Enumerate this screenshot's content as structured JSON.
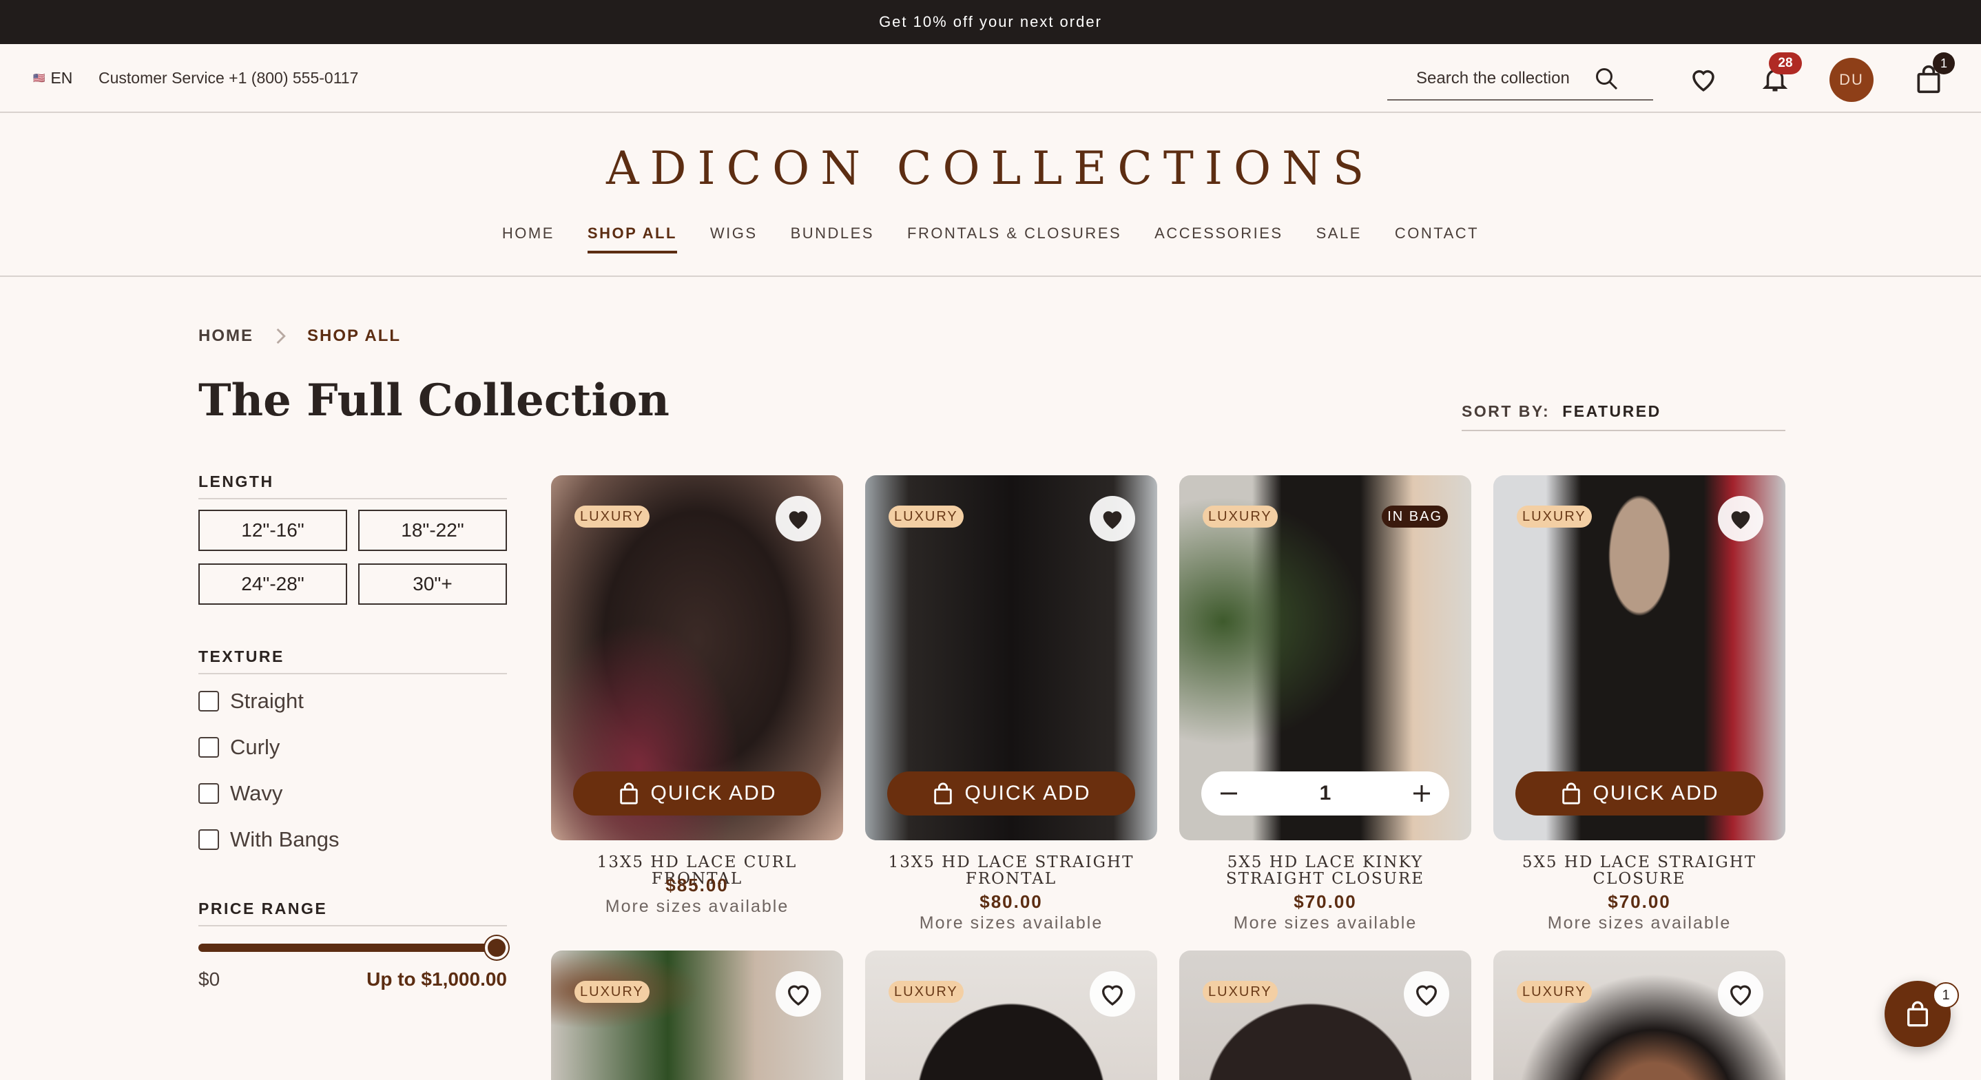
{
  "colors": {
    "brand": "#5c2d12",
    "button": "#6a2f0e",
    "badge_luxury_bg": "#f3cfa4",
    "notification": "#b02a24",
    "background": "#fcf7f4",
    "topbar": "#211c1b"
  },
  "promo": {
    "text": "Get 10% off your next order"
  },
  "util": {
    "flag_icon": "us-flag-icon",
    "lang": "EN",
    "service": "Customer Service +1 (800) 555-0117",
    "search_placeholder": "Search the collection",
    "notifications_count": "28",
    "avatar_initials": "DU",
    "cart_count": "1"
  },
  "brand": {
    "logo": "ADICON COLLECTIONS"
  },
  "nav": {
    "items": [
      "HOME",
      "SHOP ALL",
      "WIGS",
      "BUNDLES",
      "FRONTALS & CLOSURES",
      "ACCESSORIES",
      "SALE",
      "CONTACT"
    ],
    "active": "SHOP ALL"
  },
  "breadcrumb": {
    "home": "HOME",
    "current": "SHOP ALL"
  },
  "page": {
    "title": "The Full Collection"
  },
  "sort": {
    "label": "SORT BY:",
    "value": "FEATURED"
  },
  "filters": {
    "length": {
      "title": "LENGTH",
      "options": [
        "12\"-16\"",
        "18\"-22\"",
        "24\"-28\"",
        "30\"+"
      ]
    },
    "texture": {
      "title": "TEXTURE",
      "options": [
        "Straight",
        "Curly",
        "Wavy",
        "With Bangs"
      ]
    },
    "price": {
      "title": "PRICE RANGE",
      "min_label": "$0",
      "max_label": "Up to $1,000.00",
      "max_fraction": 1.0
    }
  },
  "products": [
    {
      "name": "13X5 HD LACE CURL FRONTAL",
      "price": "$85.00",
      "more": "More sizes available",
      "badge": "LUXURY",
      "wishlisted": true,
      "action": "QUICK ADD"
    },
    {
      "name": "13X5 HD LACE STRAIGHT FRONTAL",
      "price": "$80.00",
      "more": "More sizes available",
      "badge": "LUXURY",
      "wishlisted": true,
      "action": "QUICK ADD"
    },
    {
      "name": "5X5 HD LACE KINKY STRAIGHT CLOSURE",
      "price": "$70.00",
      "more": "More sizes available",
      "badge": "LUXURY",
      "bag_badge": "IN BAG",
      "quantity": "1"
    },
    {
      "name": "5X5 HD LACE STRAIGHT CLOSURE",
      "price": "$70.00",
      "more": "More sizes available",
      "badge": "LUXURY",
      "wishlisted": true,
      "action": "QUICK ADD"
    },
    {
      "badge": "LUXURY",
      "wishlisted": false
    },
    {
      "badge": "LUXURY",
      "wishlisted": false
    },
    {
      "badge": "LUXURY",
      "wishlisted": false
    },
    {
      "badge": "LUXURY",
      "wishlisted": false
    }
  ],
  "floating_cart": {
    "count": "1"
  }
}
